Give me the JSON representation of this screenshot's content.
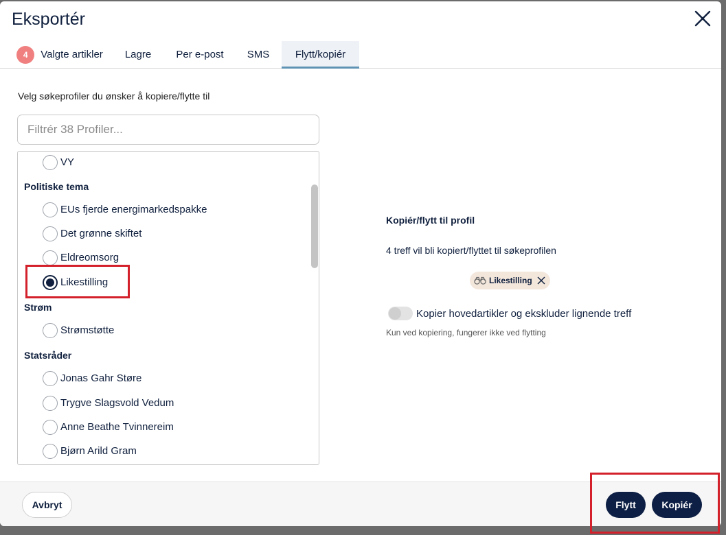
{
  "dialog": {
    "title": "Eksportér",
    "close_icon": "close-icon"
  },
  "tabs": [
    {
      "label": "Valgte artikler",
      "badge": "4"
    },
    {
      "label": "Lagre"
    },
    {
      "label": "Per e-post"
    },
    {
      "label": "SMS"
    },
    {
      "label": "Flytt/kopiér",
      "active": true
    }
  ],
  "left": {
    "instruction": "Velg søkeprofiler du ønsker å kopiere/flytte til",
    "filter_placeholder": "Filtrér 38 Profiler...",
    "list": [
      {
        "type": "item",
        "label": "VY",
        "checked": false
      },
      {
        "type": "group",
        "label": "Politiske tema"
      },
      {
        "type": "item",
        "label": "EUs fjerde energimarkedspakke",
        "checked": false
      },
      {
        "type": "item",
        "label": "Det grønne skiftet",
        "checked": false
      },
      {
        "type": "item",
        "label": "Eldreomsorg",
        "checked": false
      },
      {
        "type": "item",
        "label": "Likestilling",
        "checked": true
      },
      {
        "type": "group",
        "label": "Strøm"
      },
      {
        "type": "item",
        "label": "Strømstøtte",
        "checked": false
      },
      {
        "type": "group",
        "label": "Statsråder"
      },
      {
        "type": "item",
        "label": "Jonas Gahr Støre",
        "checked": false
      },
      {
        "type": "item",
        "label": "Trygve Slagsvold Vedum",
        "checked": false
      },
      {
        "type": "item",
        "label": "Anne Beathe Tvinnereim",
        "checked": false
      },
      {
        "type": "item",
        "label": "Bjørn Arild Gram",
        "checked": false
      }
    ]
  },
  "right": {
    "title": "Kopiér/flytt til profil",
    "description": "4 treff vil bli kopiert/flyttet til søkeprofilen",
    "chip_label": "Likestilling",
    "chip_icon": "binoculars-icon",
    "toggle_label": "Kopier hovedartikler og ekskluder lignende treff",
    "toggle_on": false,
    "hint": "Kun ved kopiering, fungerer ikke ved flytting"
  },
  "footer": {
    "cancel_label": "Avbryt",
    "move_label": "Flytt",
    "copy_label": "Kopiér"
  },
  "colors": {
    "primary": "#0d1f44",
    "badge": "#f08080",
    "active_tab_underline": "#5f93b3",
    "annotation": "#d3202a"
  }
}
